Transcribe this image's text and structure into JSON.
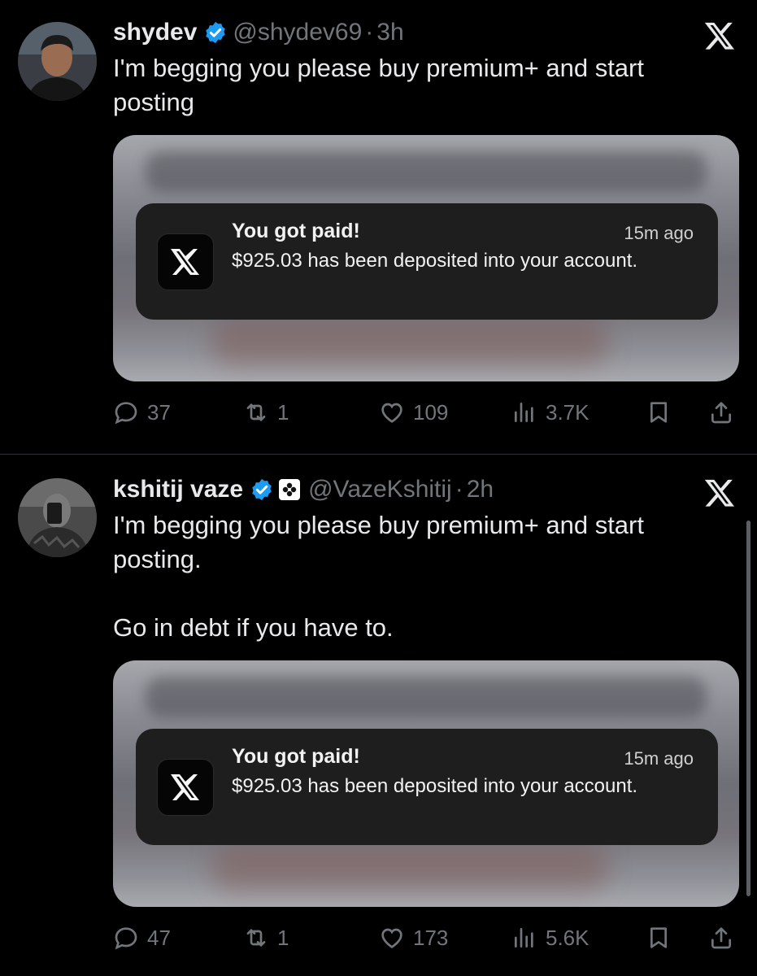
{
  "tweets": [
    {
      "name": "shydev",
      "handle": "@shydev69",
      "dot": "·",
      "time": "3h",
      "text": "I'm begging you please buy premium+ and start\nposting",
      "notification": {
        "title": "You got paid!",
        "time": "15m ago",
        "body": "$925.03 has been deposited into your account."
      },
      "actions": {
        "replies": "37",
        "reposts": "1",
        "likes": "109",
        "views": "3.7K"
      }
    },
    {
      "name": "kshitij vaze",
      "handle": "@VazeKshitij",
      "dot": "·",
      "time": "2h",
      "text": "I'm begging you please buy premium+ and start\nposting.\n\nGo in debt if you have to.",
      "notification": {
        "title": "You got paid!",
        "time": "15m ago",
        "body": "$925.03 has been deposited into your account."
      },
      "actions": {
        "replies": "47",
        "reposts": "1",
        "likes": "173",
        "views": "5.6K"
      }
    }
  ],
  "colors": {
    "background": "#000000",
    "text_primary": "#e7e9ea",
    "text_secondary": "#71767b",
    "verified_blue": "#1d9bf0",
    "divider": "#2f3336"
  },
  "icons": [
    "reply-icon",
    "repost-icon",
    "like-icon",
    "views-icon",
    "bookmark-icon",
    "share-icon",
    "x-logo-icon",
    "verified-badge-icon"
  ]
}
